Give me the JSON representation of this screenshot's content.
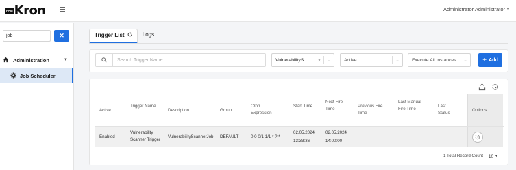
{
  "header": {
    "logo_small": "PAM",
    "logo_text": "Kron",
    "user_name": "Administrator Administrator"
  },
  "sidebar": {
    "search_value": "job",
    "clear_label": "✕",
    "menu": [
      {
        "label": "Administration",
        "icon": "home-icon",
        "expanded": true
      },
      {
        "label": "Job Scheduler",
        "icon": "gear-icon",
        "selected": true
      }
    ]
  },
  "tabs": [
    {
      "label": "Trigger List",
      "active": true
    },
    {
      "label": "Logs",
      "active": false
    }
  ],
  "filters": {
    "search_placeholder": "Search Trigger Name...",
    "job_select": "VulnerabilityS...",
    "status_select": "Active",
    "instance_select": "Execute All Instances",
    "add_label": "Add"
  },
  "table": {
    "columns": [
      "Active",
      "Trigger Name",
      "Description",
      "Group",
      "Cron Expression",
      "Start Time",
      "Next Fire Time",
      "Previous Fire Time",
      "Last Manual Fire Time",
      "Last Status",
      "Options"
    ],
    "rows": [
      {
        "active": "Enabled",
        "trigger_name": "Vulnerability Scanner Trigger",
        "description": "VulnerabilityScannerJob",
        "group": "DEFAULT",
        "cron": "0 0 0/1 1/1 * ? *",
        "start_date": "02.05.2024",
        "start_time": "13:33:36",
        "next_date": "02.05.2024",
        "next_time": "14:00:00",
        "previous_fire": "",
        "last_manual": "",
        "last_status": ""
      }
    ],
    "total_text": "1 Total Record Count",
    "page_size": "10"
  },
  "colors": {
    "accent": "#1f6fe0",
    "selected_bg": "#dde8f6"
  }
}
